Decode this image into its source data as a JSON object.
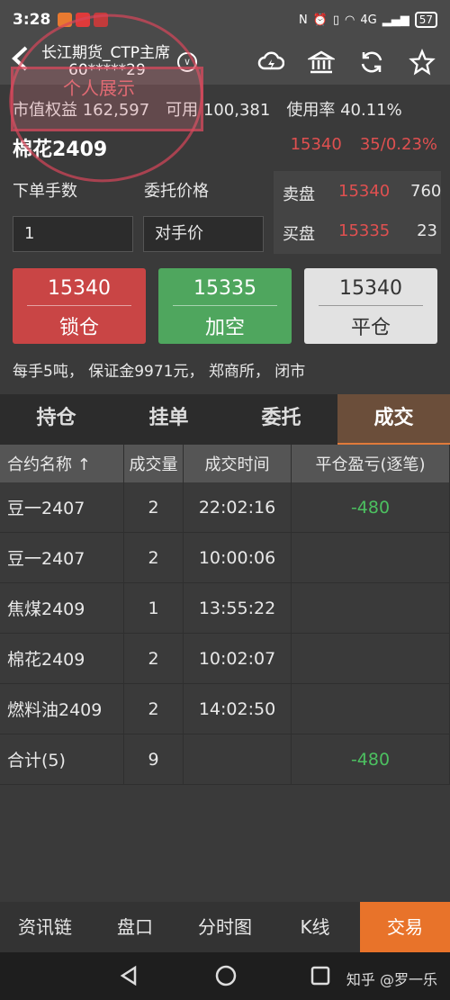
{
  "status": {
    "time": "3:28",
    "signal": "4G",
    "battery": "57"
  },
  "header": {
    "account_line1": "长江期货_CTP主席",
    "account_line2": "60*****29"
  },
  "stamp": {
    "text": "个人展示"
  },
  "account": {
    "equity_label": "市值权益",
    "equity_value": "162,597",
    "avail_label": "可用",
    "avail_value": "100,381",
    "usage_label": "使用率",
    "usage_value": "40.11%"
  },
  "symbol": {
    "name": "棉花2409",
    "price": "15340",
    "change": "35/0.23%"
  },
  "order": {
    "qty_label": "下单手数",
    "price_label": "委托价格",
    "qty_value": "1",
    "price_value": "对手价"
  },
  "book": {
    "ask_label": "卖盘",
    "ask_price": "15340",
    "ask_qty": "760",
    "bid_label": "买盘",
    "bid_price": "15335",
    "bid_qty": "23"
  },
  "buttons": {
    "lock": {
      "price": "15340",
      "label": "锁仓"
    },
    "short": {
      "price": "15335",
      "label": "加空"
    },
    "close": {
      "price": "15340",
      "label": "平仓"
    }
  },
  "info": "每手5吨， 保证金9971元， 郑商所， 闭市",
  "tabs": [
    "持仓",
    "挂单",
    "委托",
    "成交"
  ],
  "table": {
    "headers": [
      "合约名称 ↑",
      "成交量",
      "成交时间",
      "平仓盈亏(逐笔)"
    ],
    "rows": [
      {
        "name": "豆一2407",
        "qty": "2",
        "time": "22:02:16",
        "pnl": "-480"
      },
      {
        "name": "豆一2407",
        "qty": "2",
        "time": "10:00:06",
        "pnl": ""
      },
      {
        "name": "焦煤2409",
        "qty": "1",
        "time": "13:55:22",
        "pnl": ""
      },
      {
        "name": "棉花2409",
        "qty": "2",
        "time": "10:02:07",
        "pnl": ""
      },
      {
        "name": "燃料油2409",
        "qty": "2",
        "time": "14:02:50",
        "pnl": ""
      },
      {
        "name": "合计(5)",
        "qty": "9",
        "time": "",
        "pnl": "-480"
      }
    ]
  },
  "bottom_nav": [
    "资讯链",
    "盘口",
    "分时图",
    "K线",
    "交易"
  ],
  "watermark": "知乎 @罗一乐",
  "colors": {
    "red": "#e05050",
    "green": "#4cc060",
    "orange": "#e8732a"
  }
}
